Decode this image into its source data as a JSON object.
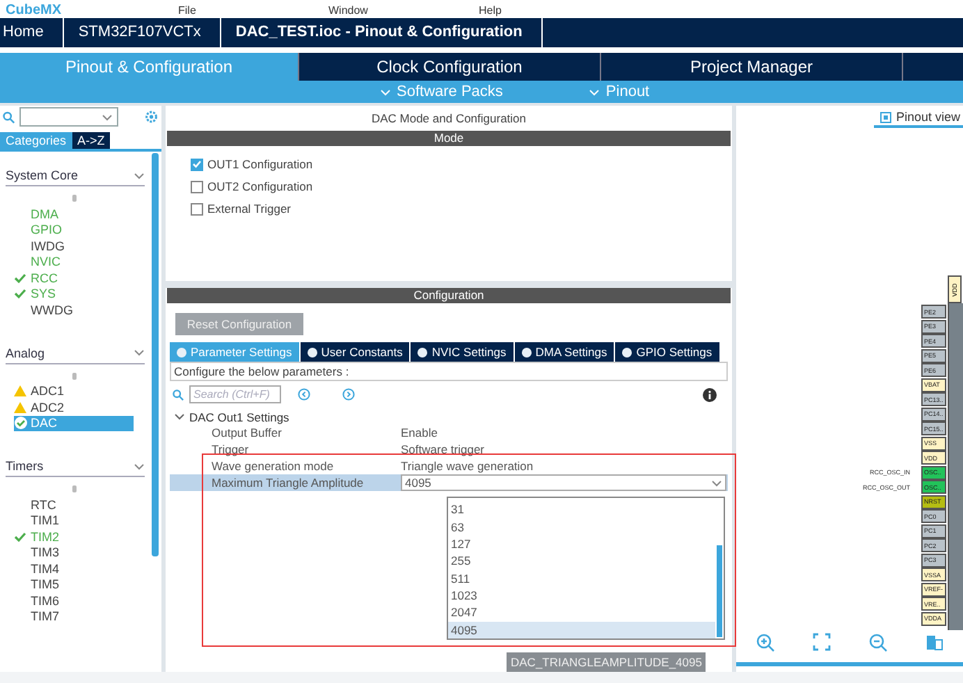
{
  "app_bar": {
    "logo": "CubeMX",
    "menu": [
      "File",
      "Window",
      "Help"
    ]
  },
  "breadcrumbs": [
    {
      "label": "Home",
      "current": false
    },
    {
      "label": "STM32F107VCTx",
      "current": false
    },
    {
      "label": "DAC_TEST.ioc - Pinout & Configuration",
      "current": true
    }
  ],
  "main_tabs": [
    {
      "label": "Pinout & Configuration",
      "selected": true
    },
    {
      "label": "Clock Configuration",
      "selected": false
    },
    {
      "label": "Project Manager",
      "selected": false
    }
  ],
  "sub_menus": [
    "Software Packs",
    "Pinout"
  ],
  "sidebar": {
    "view_tabs": [
      {
        "label": "Categories",
        "selected": true
      },
      {
        "label": "A->Z",
        "selected": false
      }
    ],
    "groups": [
      {
        "title": "System Core",
        "items": [
          {
            "label": "DMA",
            "configured": true,
            "checked": false,
            "warning": false,
            "selected": false
          },
          {
            "label": "GPIO",
            "configured": true,
            "checked": false,
            "warning": false,
            "selected": false
          },
          {
            "label": "IWDG",
            "configured": false,
            "checked": false,
            "warning": false,
            "selected": false
          },
          {
            "label": "NVIC",
            "configured": true,
            "checked": false,
            "warning": false,
            "selected": false
          },
          {
            "label": "RCC",
            "configured": true,
            "checked": true,
            "warning": false,
            "selected": false
          },
          {
            "label": "SYS",
            "configured": true,
            "checked": true,
            "warning": false,
            "selected": false
          },
          {
            "label": "WWDG",
            "configured": false,
            "checked": false,
            "warning": false,
            "selected": false
          }
        ]
      },
      {
        "title": "Analog",
        "items": [
          {
            "label": "ADC1",
            "configured": false,
            "checked": false,
            "warning": true,
            "selected": false
          },
          {
            "label": "ADC2",
            "configured": false,
            "checked": false,
            "warning": true,
            "selected": false
          },
          {
            "label": "DAC",
            "configured": true,
            "checked": true,
            "warning": false,
            "selected": true
          }
        ]
      },
      {
        "title": "Timers",
        "items": [
          {
            "label": "RTC",
            "configured": false,
            "checked": false,
            "warning": false,
            "selected": false
          },
          {
            "label": "TIM1",
            "configured": false,
            "checked": false,
            "warning": false,
            "selected": false
          },
          {
            "label": "TIM2",
            "configured": true,
            "checked": true,
            "warning": false,
            "selected": false
          },
          {
            "label": "TIM3",
            "configured": false,
            "checked": false,
            "warning": false,
            "selected": false
          },
          {
            "label": "TIM4",
            "configured": false,
            "checked": false,
            "warning": false,
            "selected": false
          },
          {
            "label": "TIM5",
            "configured": false,
            "checked": false,
            "warning": false,
            "selected": false
          },
          {
            "label": "TIM6",
            "configured": false,
            "checked": false,
            "warning": false,
            "selected": false
          },
          {
            "label": "TIM7",
            "configured": false,
            "checked": false,
            "warning": false,
            "selected": false
          }
        ]
      }
    ]
  },
  "panel": {
    "title": "DAC Mode and Configuration",
    "mode": {
      "title": "Mode",
      "options": [
        {
          "label": "OUT1 Configuration",
          "checked": true
        },
        {
          "label": "OUT2 Configuration",
          "checked": false
        },
        {
          "label": "External Trigger",
          "checked": false
        }
      ]
    },
    "configuration": {
      "title": "Configuration",
      "reset_button": "Reset Configuration",
      "tabs": [
        {
          "label": "Parameter Settings",
          "selected": true
        },
        {
          "label": "User Constants",
          "selected": false
        },
        {
          "label": "NVIC Settings",
          "selected": false
        },
        {
          "label": "DMA Settings",
          "selected": false
        },
        {
          "label": "GPIO Settings",
          "selected": false
        }
      ],
      "hint": "Configure the below parameters :",
      "search": {
        "placeholder": "Search (Ctrl+F)"
      },
      "group": {
        "title": "DAC Out1 Settings",
        "expanded": true,
        "params": [
          {
            "name": "Output Buffer",
            "value": "Enable",
            "selected": false
          },
          {
            "name": "Trigger",
            "value": "Software trigger",
            "selected": false
          },
          {
            "name": "Wave generation mode",
            "value": "Triangle wave generation",
            "selected": false
          },
          {
            "name": "Maximum Triangle Amplitude",
            "value": "4095",
            "selected": true
          }
        ]
      },
      "dropdown": {
        "options": [
          {
            "label": "31",
            "selected": false
          },
          {
            "label": "63",
            "selected": false
          },
          {
            "label": "127",
            "selected": false
          },
          {
            "label": "255",
            "selected": false
          },
          {
            "label": "511",
            "selected": false
          },
          {
            "label": "1023",
            "selected": false
          },
          {
            "label": "2047",
            "selected": false
          },
          {
            "label": "4095",
            "selected": true
          }
        ]
      },
      "tooltip": "DAC_TRIANGLEAMPLITUDE_4095"
    }
  },
  "pinout": {
    "view_tab": "Pinout view",
    "top_pin": {
      "label": "VDD",
      "color": "#fff3c4"
    },
    "pins": [
      {
        "label": "PE2",
        "color": "#b9c2c9"
      },
      {
        "label": "PE3",
        "color": "#b9c2c9"
      },
      {
        "label": "PE4",
        "color": "#b9c2c9"
      },
      {
        "label": "PE5",
        "color": "#b9c2c9"
      },
      {
        "label": "PE6",
        "color": "#b9c2c9"
      },
      {
        "label": "VBAT",
        "color": "#fff3c4"
      },
      {
        "label": "PC13..",
        "color": "#b9c2c9"
      },
      {
        "label": "PC14..",
        "color": "#b9c2c9"
      },
      {
        "label": "PC15..",
        "color": "#b9c2c9"
      },
      {
        "label": "VSS",
        "color": "#fff3c4"
      },
      {
        "label": "VDD",
        "color": "#fff3c4"
      },
      {
        "label": "OSC..",
        "color": "#22c35a",
        "signal": "RCC_OSC_IN"
      },
      {
        "label": "OSC..",
        "color": "#22c35a",
        "signal": "RCC_OSC_OUT"
      },
      {
        "label": "NRST",
        "color": "#b5bd12"
      },
      {
        "label": "PC0",
        "color": "#b9c2c9"
      },
      {
        "label": "PC1",
        "color": "#b9c2c9"
      },
      {
        "label": "PC2",
        "color": "#b9c2c9"
      },
      {
        "label": "PC3",
        "color": "#b9c2c9"
      },
      {
        "label": "VSSA",
        "color": "#fff3c4"
      },
      {
        "label": "VREF-",
        "color": "#fff3c4"
      },
      {
        "label": "VRE..",
        "color": "#fff3c4"
      },
      {
        "label": "VDDA",
        "color": "#fff3c4"
      }
    ]
  }
}
